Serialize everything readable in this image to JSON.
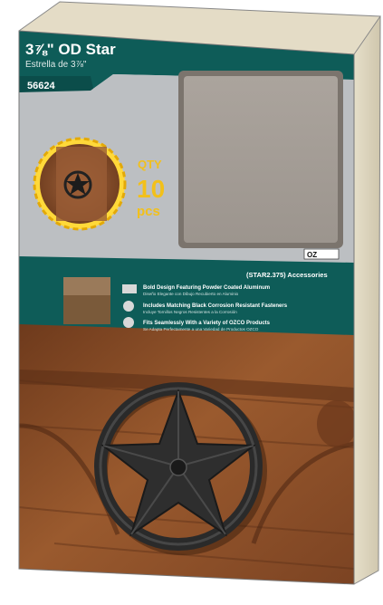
{
  "product": {
    "title": "3⅞\" OD Star",
    "subtitle_es": "Estrella de 3⅞\"",
    "sku": "56624",
    "qty_label": "QTY",
    "qty_value": "10",
    "qty_unit": "pcs",
    "accessories_label": "(STAR2.375) Accessories",
    "brand": "OZ",
    "features": [
      {
        "icon": "steel-badge-icon",
        "line1": "Bold Design Featuring Powder Coated Aluminum",
        "line2": "Diseño Elegante con Dibujo Recubierto en Aluminio"
      },
      {
        "icon": "screw-icon",
        "line1": "Includes Matching Black Corrosion Resistant Fasteners",
        "line2": "Incluye Tornillos Negros Resistentes a la Corrosión"
      },
      {
        "icon": "chain-icon",
        "line1": "Fits Seamlessly With a Variety of OZCO Products",
        "line2": "Se Adapta Perfectamente a una Variedad de Productos OZCO"
      }
    ]
  },
  "colors": {
    "teal": "#0e5c58",
    "gold": "#f2c01a",
    "wood": "#8a4a24",
    "panel": "#b9bcbf",
    "window": "#a39c95"
  }
}
